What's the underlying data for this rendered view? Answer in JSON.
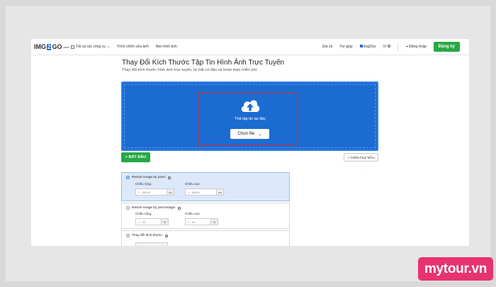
{
  "nav": {
    "logo_a": "IMG",
    "logo_b": "2",
    "logo_c": "GO",
    "logo_suffix": ".com",
    "all_tools": "Tất cả các công cụ",
    "photo_editor": "Trình chỉnh sửa ảnh",
    "compress": "Nén hình ảnh",
    "pricing": "Giá cả",
    "help": "Trợ giúp",
    "app": "Img2Go",
    "lang": "VI",
    "login": "Đăng nhập",
    "signup": "Đăng ký"
  },
  "header": {
    "title": "Thay Đổi Kích Thước Tập Tin Hình Ảnh Trực Tuyến",
    "subtitle": "Thay đổi kích thước hình ảnh trực tuyến, từ bất cứ đâu và hoàn toàn miễn phí."
  },
  "upload": {
    "drop_text": "Thả tập tin tại đây",
    "choose_label": "Chọn file",
    "choose_caret": "⌄"
  },
  "actions": {
    "start_label": "> BẮT ĐẦU",
    "sample_label": "+ THÊM FILE MẪU"
  },
  "options": {
    "pixel": {
      "label": "Resize image by pixel:",
      "width_label": "Chiều rộng:",
      "height_label": "Chiều cao:",
      "width_placeholder": "1 - 65000",
      "height_placeholder": "1 - 65000",
      "unit": "px"
    },
    "percentage": {
      "label": "Resize image by percentage:",
      "width_label": "Chiều rộng:",
      "height_label": "Chiều cao:",
      "width_placeholder": "1 - 90",
      "height_placeholder": "1 - 90",
      "unit": "%"
    },
    "size": {
      "label": "Thay đổi kích thước:"
    }
  },
  "watermark": "mytour.vn",
  "colors": {
    "brand_blue": "#1c6bd0",
    "accent_green": "#27a844",
    "highlight_red": "#d12b2b",
    "watermark_pink": "#e8336f"
  },
  "icons": [
    "grid-icon",
    "upload-cloud-icon",
    "info-icon",
    "login-icon",
    "chevron-down-icon"
  ]
}
